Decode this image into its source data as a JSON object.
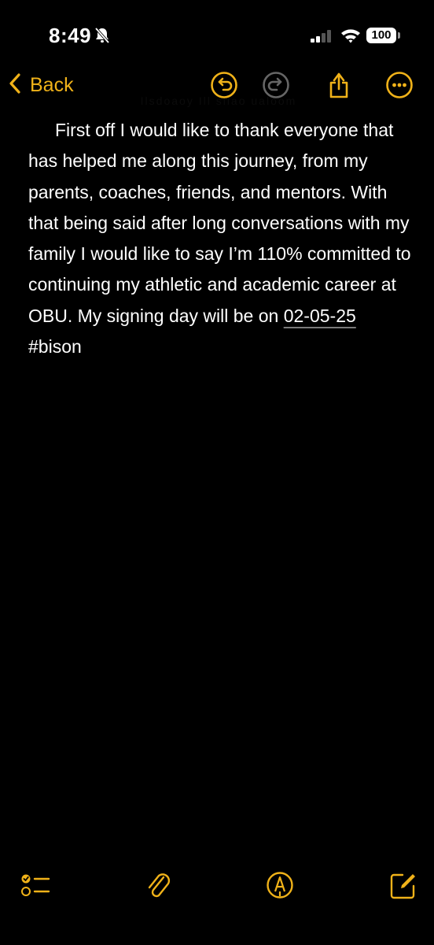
{
  "status_bar": {
    "time": "8:49",
    "battery": "100",
    "icons": [
      "bell-slash-icon",
      "cellular-signal-icon",
      "wifi-icon",
      "battery-icon"
    ]
  },
  "nav": {
    "back_label": "Back",
    "ghost_title": "Ilsdoaoy Ill sliao ualoom",
    "icons": [
      "chevron-left-icon",
      "undo-icon",
      "redo-icon",
      "share-icon",
      "more-icon"
    ]
  },
  "note": {
    "body": "First off I would like to thank everyone that has helped me along this journey, from my parents, coaches, friends, and mentors. With that being said after long conversations with my family I would like to say I’m 110% committed to continuing my athletic and academic career at OBU. My signing day will be on",
    "date": "02-05-25",
    "hashtag": " #bison"
  },
  "toolbar": {
    "icons": [
      "checklist-icon",
      "paperclip-icon",
      "markup-icon",
      "compose-icon"
    ]
  },
  "colors": {
    "accent": "#f0b219",
    "background": "#000000",
    "text": "#ffffff"
  }
}
